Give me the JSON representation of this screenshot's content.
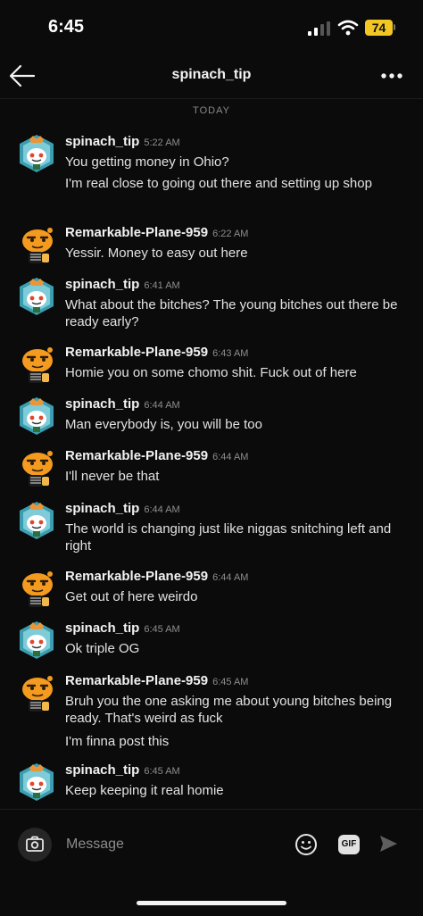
{
  "status_bar": {
    "time": "6:45",
    "battery": "74"
  },
  "header": {
    "title": "spinach_tip"
  },
  "divider": "TODAY",
  "messages": [
    {
      "author": "spinach_tip",
      "time": "5:22 AM",
      "lines": [
        "You getting money in Ohio?",
        "I'm real close to going out there and setting up shop"
      ]
    },
    {
      "author": "Remarkable-Plane-959",
      "time": "6:22 AM",
      "lines": [
        "Yessir. Money to easy out here"
      ]
    },
    {
      "author": "spinach_tip",
      "time": "6:41 AM",
      "lines": [
        "What about the bitches? The young bitches out there be ready early?"
      ]
    },
    {
      "author": "Remarkable-Plane-959",
      "time": "6:43 AM",
      "lines": [
        "Homie you on some chomo shit. Fuck out of here"
      ]
    },
    {
      "author": "spinach_tip",
      "time": "6:44 AM",
      "lines": [
        "Man everybody is, you will be too"
      ]
    },
    {
      "author": "Remarkable-Plane-959",
      "time": "6:44 AM",
      "lines": [
        "I'll never be that"
      ]
    },
    {
      "author": "spinach_tip",
      "time": "6:44 AM",
      "lines": [
        "The world is changing just like niggas snitching left and right"
      ]
    },
    {
      "author": "Remarkable-Plane-959",
      "time": "6:44 AM",
      "lines": [
        "Get out of here weirdo"
      ]
    },
    {
      "author": "spinach_tip",
      "time": "6:45 AM",
      "lines": [
        "Ok triple OG"
      ]
    },
    {
      "author": "Remarkable-Plane-959",
      "time": "6:45 AM",
      "lines": [
        "Bruh you the one asking me about young bitches being ready. That's weird as fuck",
        "I'm finna post this"
      ]
    },
    {
      "author": "spinach_tip",
      "time": "6:45 AM",
      "lines": [
        "Keep keeping it real homie"
      ]
    }
  ],
  "composer": {
    "placeholder": "Message",
    "gif_label": "GIF"
  },
  "colors": {
    "background": "#0b0b0b",
    "battery": "#f3c623",
    "snoo_orange": "#f39a1f",
    "snoo_teal": "#3b9db0"
  }
}
